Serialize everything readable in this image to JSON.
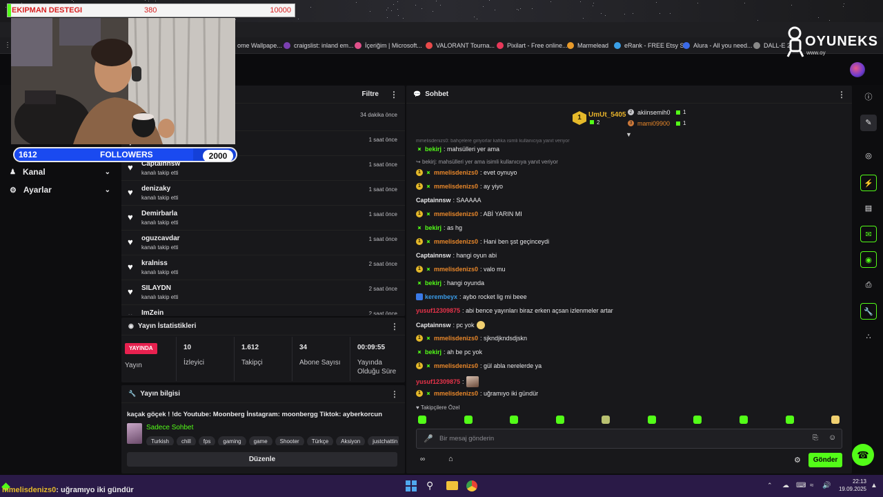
{
  "overlay": {
    "goal_label": "EKIPMAN DESTEGI",
    "goal_current": "380",
    "goal_target": "10000",
    "followers_current": "1612",
    "followers_label": "FOLLOWERS",
    "followers_target": "2000",
    "followers_progress": 0.806,
    "bottom_alert_user": "mmelisdenizs0",
    "bottom_alert_text": ": uğramıyo iki gündür"
  },
  "bookmarks": [
    {
      "label": "ome Wallpape...",
      "color": "#777777"
    },
    {
      "label": "craigslist: inland em...",
      "color": "#7a3fb0"
    },
    {
      "label": "İçeriğim | Microsoft...",
      "color": "#e0508a"
    },
    {
      "label": "VALORANT Tourna...",
      "color": "#e84a4a"
    },
    {
      "label": "Pixilart - Free online...",
      "color": "#e8385a"
    },
    {
      "label": "Marmelead",
      "color": "#e89a2a"
    },
    {
      "label": "eRank - FREE Etsy S...",
      "color": "#3aa0e8"
    },
    {
      "label": "Alura - All you need...",
      "color": "#3a6ae8"
    },
    {
      "label": "DALL-E 2",
      "color": "#888888"
    }
  ],
  "logo": {
    "brand": "OYUNEKS",
    "url": "www.oy"
  },
  "sidebar": {
    "items": [
      {
        "label": "Kanal"
      },
      {
        "label": "Ayarlar"
      }
    ]
  },
  "followers_panel": {
    "filter_label": "Filtre",
    "rows": [
      {
        "name": "",
        "sub": "",
        "time": "34 dakika önce"
      },
      {
        "name": "",
        "sub": "",
        "time": "1 saat önce"
      },
      {
        "name": "Captainnsw",
        "sub": "kanalı takip etti",
        "time": "1 saat önce"
      },
      {
        "name": "denizaky",
        "sub": "kanalı takip etti",
        "time": "1 saat önce"
      },
      {
        "name": "Demirbarla",
        "sub": "kanalı takip etti",
        "time": "1 saat önce"
      },
      {
        "name": "oguzcavdar",
        "sub": "kanalı takip etti",
        "time": "1 saat önce"
      },
      {
        "name": "kralniss",
        "sub": "kanalı takip etti",
        "time": "2 saat önce"
      },
      {
        "name": "SILAYDN",
        "sub": "kanalı takip etti",
        "time": "2 saat önce"
      },
      {
        "name": "ImZein",
        "sub": "",
        "time": "2 saat önce"
      }
    ]
  },
  "stats_panel": {
    "title": "Yayın İstatistikleri",
    "live_badge": "YAYINDA",
    "live_label": "Yayın",
    "cells": [
      {
        "value": "10",
        "label": "İzleyici"
      },
      {
        "value": "1.612",
        "label": "Takipçi"
      },
      {
        "value": "34",
        "label": "Abone Sayısı"
      },
      {
        "value": "00:09:55",
        "label": "Yayında Olduğu Süre"
      }
    ]
  },
  "info_panel": {
    "title": "Yayın bilgisi",
    "stream_title": "kaçak göçek ! !dc Youtube: Moonberg İnstagram: moonbergg Tiktok: ayberkorcun",
    "category": "Sadece Sohbet",
    "tags": [
      "Turkish",
      "chill",
      "fps",
      "gaming",
      "game",
      "Shooter",
      "Türkçe",
      "Aksiyon",
      "justchattin"
    ],
    "edit_label": "Düzenle"
  },
  "chat": {
    "title": "Sohbet",
    "leaderboard": {
      "first": {
        "rank": "1",
        "name": "UmUt_5405",
        "count": "2"
      },
      "second": {
        "rank": "2",
        "name": "akiinsemih0",
        "count": "1"
      },
      "third": {
        "rank": "3",
        "name": "mami09900",
        "count": "1"
      }
    },
    "top_reply": "mmelisdenizs0: bahçelere giriyorlar kafika isimli kullanıcıya yanıt veriyor",
    "messages": [
      {
        "type": "msg",
        "badges": [
          "gift"
        ],
        "user": "bekirj",
        "color": "#53fc18",
        "text": ": mahsülleri yer ama"
      },
      {
        "type": "reply",
        "text": "bekirj: mahsülleri yer ama isimli kullanıcıya yanıt veriyor"
      },
      {
        "type": "msg",
        "badges": [
          "sub",
          "gift"
        ],
        "user": "mmelisdenizs0",
        "color": "#e8872a",
        "text": ": evet oynuyo"
      },
      {
        "type": "msg",
        "badges": [
          "sub",
          "gift"
        ],
        "user": "mmelisdenizs0",
        "color": "#e8872a",
        "text": ": ay yiyo"
      },
      {
        "type": "msg",
        "badges": [],
        "user": "Captainnsw",
        "color": "#e8e8ea",
        "text": ": SAAAAA"
      },
      {
        "type": "msg",
        "badges": [
          "sub",
          "gift"
        ],
        "user": "mmelisdenizs0",
        "color": "#e8872a",
        "text": ": ABİ YARIN MI"
      },
      {
        "type": "msg",
        "badges": [
          "gift"
        ],
        "user": "bekirj",
        "color": "#53fc18",
        "text": ": as hg"
      },
      {
        "type": "msg",
        "badges": [
          "sub",
          "gift"
        ],
        "user": "mmelisdenizs0",
        "color": "#e8872a",
        "text": ": Hani ben şst geçinceydi"
      },
      {
        "type": "msg",
        "badges": [],
        "user": "Captainnsw",
        "color": "#e8e8ea",
        "text": ": hangi oyun abi"
      },
      {
        "type": "msg",
        "badges": [
          "sub",
          "gift"
        ],
        "user": "mmelisdenizs0",
        "color": "#e8872a",
        "text": ": valo mu"
      },
      {
        "type": "msg",
        "badges": [
          "gift"
        ],
        "user": "bekirj",
        "color": "#53fc18",
        "text": ": hangi oyunda"
      },
      {
        "type": "msg",
        "badges": [
          "mod"
        ],
        "user": "kerembeyx",
        "color": "#3a9be8",
        "text": ": aybo rocket lig mi beee"
      },
      {
        "type": "msg",
        "badges": [],
        "user": "yusuf12309875",
        "color": "#e8334a",
        "text": ": abi bence yayınları biraz erken açsan izlenmeler artar"
      },
      {
        "type": "msg",
        "badges": [],
        "user": "Captainnsw",
        "color": "#e8e8ea",
        "text": ": pc yok",
        "emoji": true
      },
      {
        "type": "msg",
        "badges": [
          "sub",
          "gift"
        ],
        "user": "mmelisdenizs0",
        "color": "#e8872a",
        "text": ": sjkndjkndsdjskn"
      },
      {
        "type": "msg",
        "badges": [
          "gift"
        ],
        "user": "bekirj",
        "color": "#53fc18",
        "text": ": ah be pc yok"
      },
      {
        "type": "msg",
        "badges": [
          "sub",
          "gift"
        ],
        "user": "mmelisdenizs0",
        "color": "#e8872a",
        "text": ": gül abla nerelerde ya"
      },
      {
        "type": "msg",
        "badges": [],
        "user": "yusuf12309875",
        "color": "#e8334a",
        "text": ":",
        "img": true
      },
      {
        "type": "msg",
        "badges": [
          "sub",
          "gift"
        ],
        "user": "mmelisdenizs0",
        "color": "#e8872a",
        "text": ": uğramıyo iki gündür"
      }
    ],
    "emote_section_label": "Takipçilere Özel",
    "input_placeholder": "Bir mesaj gönderin",
    "send_label": "Gönder"
  },
  "taskbar": {
    "time": "22:13",
    "date": "19.09.2025"
  },
  "colors": {
    "accent": "#53fc18",
    "panel": "#18181b",
    "background": "#0d0d0f",
    "live": "#e8214f"
  }
}
